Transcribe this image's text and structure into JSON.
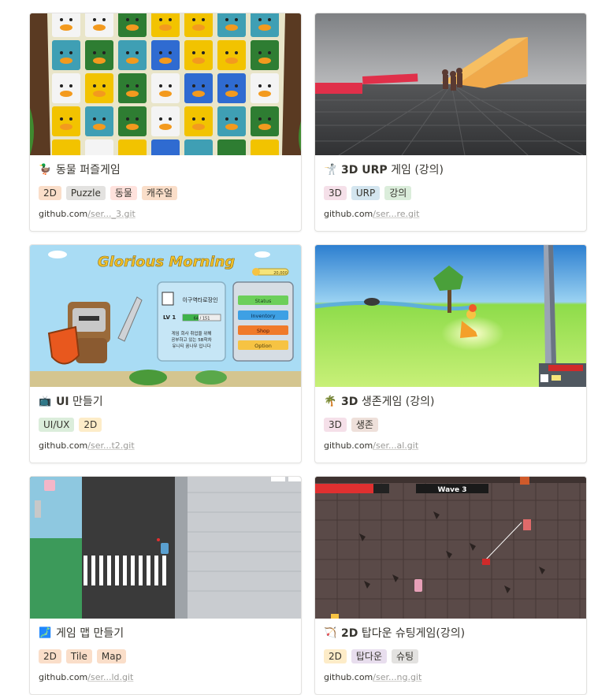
{
  "cards": [
    {
      "emoji": "🦆",
      "title_bold": "",
      "title_rest": "동물 퍼즐게임",
      "tags": [
        "2D",
        "Puzzle",
        "동물",
        "캐주얼"
      ],
      "url_domain": "github.com",
      "url_rest": "/ser..._3.git"
    },
    {
      "emoji": "🤺",
      "title_bold": "3D URP",
      "title_rest": " 게임 (강의)",
      "tags": [
        "3D",
        "URP",
        "강의"
      ],
      "url_domain": "github.com",
      "url_rest": "/ser...re.git"
    },
    {
      "emoji": "📺",
      "title_bold": "UI",
      "title_rest": " 만들기",
      "tags": [
        "UI/UX",
        "2D"
      ],
      "url_domain": "github.com",
      "url_rest": "/ser...t2.git",
      "cover": {
        "banner": "Glorious Morning",
        "gold": "20,000",
        "name": "이구역타로장인",
        "level": "LV 1",
        "exp": "64 / 151",
        "desc1": "게임 회사 취업을 위해",
        "desc2": "공부하고 있는 5B학차",
        "desc3": "유니티 꿈나무 입니다",
        "buttons": [
          "Status",
          "Inventory",
          "Shop",
          "Option"
        ]
      }
    },
    {
      "emoji": "🌴",
      "title_bold": "3D",
      "title_rest": " 생존게임 (강의)",
      "tags": [
        "3D",
        "생존"
      ],
      "url_domain": "github.com",
      "url_rest": "/ser...al.git"
    },
    {
      "emoji": "🗾",
      "title_bold": "",
      "title_rest": "게임 맵 만들기",
      "tags": [
        "2D",
        "Tile",
        "Map"
      ],
      "url_domain": "github.com",
      "url_rest": "/ser...ld.git"
    },
    {
      "emoji": "🏹",
      "title_bold": "2D",
      "title_rest": " 탑다운 슈팅게임(강의)",
      "tags": [
        "2D",
        "탑다운",
        "슈팅"
      ],
      "url_domain": "github.com",
      "url_rest": "/ser...ng.git",
      "cover": {
        "wave": "Wave   3"
      }
    }
  ],
  "colors": {
    "accent_gold": "#f6c343",
    "border": "#e3e2e0"
  }
}
